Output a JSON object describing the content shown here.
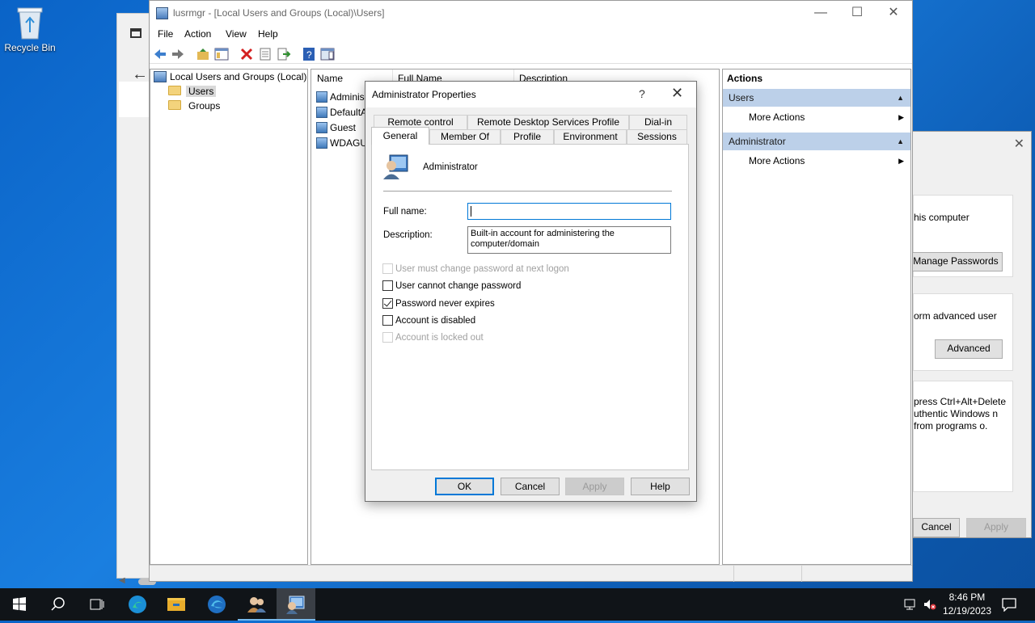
{
  "desktop": {
    "recycle_bin_label": "Recycle Bin"
  },
  "main_window": {
    "title": "lusrmgr - [Local Users and Groups (Local)\\Users]",
    "controls": {
      "minimize": "—",
      "maximize": "☐",
      "close": "✕"
    },
    "menu": [
      "File",
      "Action",
      "View",
      "Help"
    ],
    "tree": {
      "root": "Local Users and Groups (Local)",
      "items": [
        "Users",
        "Groups"
      ]
    },
    "list": {
      "columns": [
        "Name",
        "Full Name",
        "Description"
      ],
      "rows": [
        "Adminis",
        "DefaultA",
        "Guest",
        "WDAGU"
      ]
    },
    "actions": {
      "header": "Actions",
      "sections": [
        {
          "title": "Users",
          "item": "More Actions"
        },
        {
          "title": "Administrator",
          "item": "More Actions"
        }
      ]
    }
  },
  "dialog": {
    "title": "Administrator Properties",
    "help_glyph": "?",
    "close_glyph": "✕",
    "tabs_row1": [
      "Remote control",
      "Remote Desktop Services Profile",
      "Dial-in"
    ],
    "tabs_row2": [
      "General",
      "Member Of",
      "Profile",
      "Environment",
      "Sessions"
    ],
    "username": "Administrator",
    "fullname_label": "Full name:",
    "fullname_value": "",
    "description_label": "Description:",
    "description_value": "Built-in account for administering the computer/domain",
    "checkboxes": [
      {
        "label": "User must change password at next logon",
        "checked": false,
        "enabled": false
      },
      {
        "label": "User cannot change password",
        "checked": false,
        "enabled": true
      },
      {
        "label": "Password never expires",
        "checked": true,
        "enabled": true
      },
      {
        "label": "Account is disabled",
        "checked": false,
        "enabled": true
      },
      {
        "label": "Account is locked out",
        "checked": false,
        "enabled": false
      }
    ],
    "buttons": {
      "ok": "OK",
      "cancel": "Cancel",
      "apply": "Apply",
      "help": "Help"
    }
  },
  "background_window": {
    "close_glyph": "✕",
    "text1": "his computer",
    "btn_manage": "Manage Passwords",
    "text2": "orm advanced user",
    "btn_advanced": "Advanced",
    "text3": "press Ctrl+Alt+Delete uthentic Windows n from programs o.",
    "btn_cancel": "Cancel",
    "btn_apply": "Apply"
  },
  "taskbar": {
    "time": "8:46 PM",
    "date": "12/19/2023"
  },
  "colors": {
    "accent": "#0078d7",
    "action_section": "#bcd0e9",
    "taskbar": "#101418"
  }
}
